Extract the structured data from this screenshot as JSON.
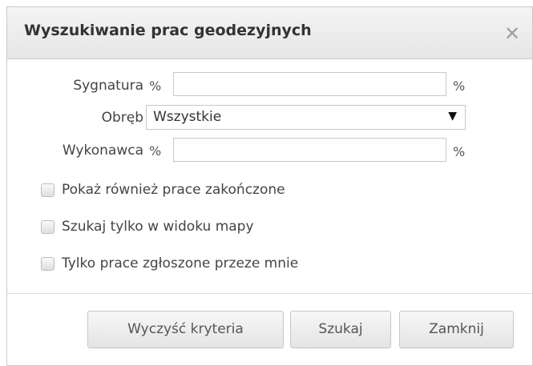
{
  "dialog": {
    "title": "Wyszukiwanie prac geodezyjnych",
    "close_icon": "close-icon"
  },
  "form": {
    "signature": {
      "label": "Sygnatura",
      "prefix": "%",
      "suffix": "%",
      "value": ""
    },
    "precinct": {
      "label": "Obręb",
      "selected": "Wszystkie",
      "arrow_icon": "dropdown-arrow-icon"
    },
    "contractor": {
      "label": "Wykonawca",
      "prefix": "%",
      "suffix": "%",
      "value": ""
    }
  },
  "options": [
    {
      "label": "Pokaż również prace zakończone",
      "checked": false
    },
    {
      "label": "Szukaj tylko w widoku mapy",
      "checked": false
    },
    {
      "label": "Tylko prace zgłoszone przeze mnie",
      "checked": false
    }
  ],
  "buttons": {
    "clear": "Wyczyść kryteria",
    "search": "Szukaj",
    "close": "Zamknij"
  }
}
